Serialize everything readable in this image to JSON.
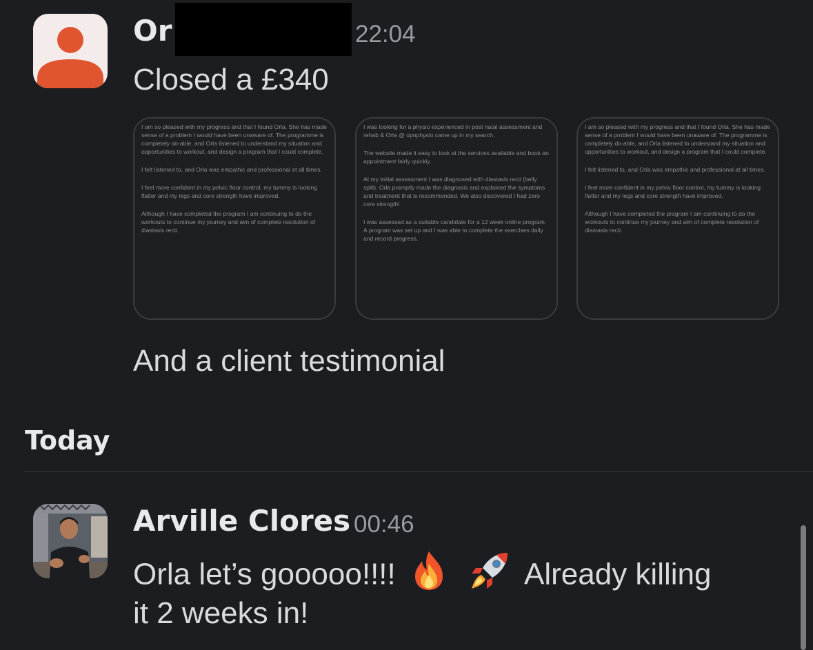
{
  "messages": [
    {
      "author_visible": "Or",
      "time": "22:04",
      "avatar": "default-user-icon",
      "lines": [
        "Closed a £340"
      ],
      "attachments": [
        {
          "paragraphs": [
            "I am so pleased with my progress and that I found Orla. She has made sense of a problem I would have been unaware of. The programme is completely do-able, and Orla listened to understand my situation and opportunities to workout, and design a program that I could complete.",
            "I felt listened to, and Orla was empathic and professional at all times.",
            "I feel more confident in my pelvic floor control, my tummy is looking flatter and my legs and core strength have improved.",
            "Although I have completed the program I am continuing to do the workouts to continue my journey and aim of complete resolution of diastasis recti."
          ]
        },
        {
          "paragraphs": [
            "I was looking for a physio experienced in post natal assessment and rehab & Orla @ opnphysio came up in my search.",
            "The website made it easy to look at the services available and book an appointment fairly quickly.",
            "At my initial assessment I was diagnosed with diastasis recti (belly split). Orla promptly made the diagnosis and explained the symptoms and treatment that is recommended. We also discovered I had zero core strength!",
            "I was assessed as a suitable candidate for a 12 week online program. A program was set up and I was able to complete the exercises daily and record progress."
          ]
        },
        {
          "paragraphs": [
            "I am so pleased with my progress and that I found Orla. She has made sense of a problem I would have been unaware of. The programme is completely do-able, and Orla listened to understand my situation and opportunities to workout, and design a program that I could complete.",
            "I felt listened to, and Orla was empathic and professional at all times.",
            "I feel more confident in my pelvic floor control, my tummy is looking flatter and my legs and core strength have improved.",
            "Although I have completed the program I am continuing to do the workouts to continue my journey and aim of complete resolution of diastasis recti."
          ]
        }
      ],
      "follow_up": "And a client testimonial"
    },
    {
      "author": "Arville Clores",
      "time": "00:46",
      "avatar": "profile-photo",
      "line1_a": "Orla let’s gooooo!!!!",
      "line1_b": "Already killing",
      "line2": "it 2 weeks in!",
      "emojis": [
        "fire-emoji",
        "rocket-emoji"
      ]
    }
  ],
  "day_divider": "Today",
  "colors": {
    "background": "#1b1d21",
    "name": "#e8e9ea",
    "time": "#999ba0",
    "text": "#dadbdc",
    "default_avatar_bg": "#f4ecea",
    "default_avatar_fg": "#e0552f"
  }
}
